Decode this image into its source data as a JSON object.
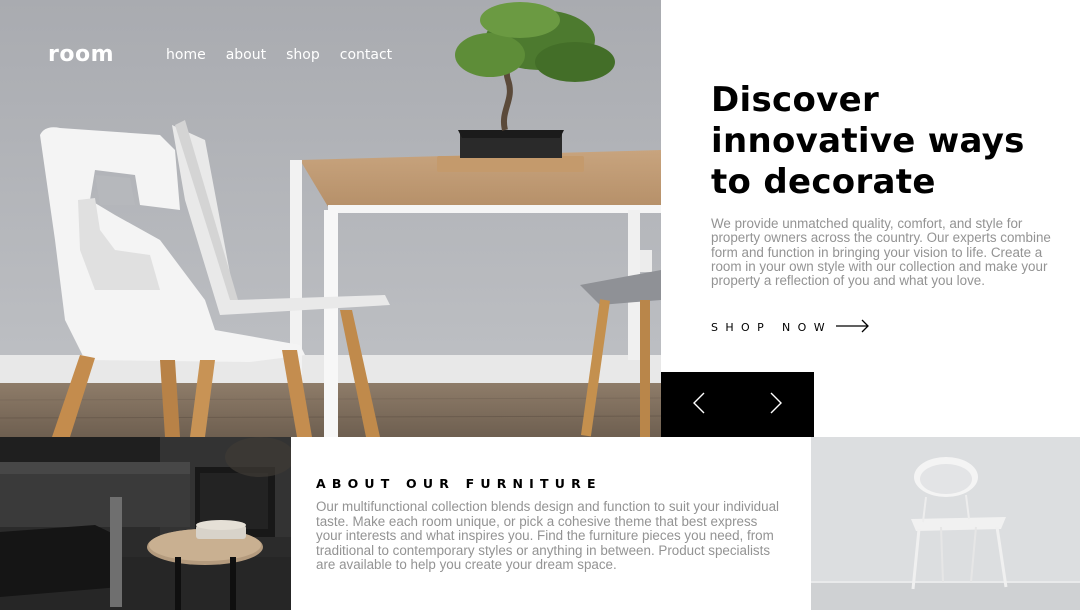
{
  "header": {
    "logo": "room",
    "nav": [
      "home",
      "about",
      "shop",
      "contact"
    ]
  },
  "hero": {
    "image_alt": "White chairs around a wooden table with a bonsai tree",
    "title_lines": [
      "Discover",
      "innovative ways",
      "to decorate"
    ],
    "description": "We provide unmatched quality, comfort, and style for property owners across the country. Our experts combine form and function in bringing your vision to life. Create a room in your own style with our collection and make your property a reflection of you and what you love.",
    "cta_label": "SHOP NOW",
    "cta_icon": "arrow-right-icon"
  },
  "slider": {
    "prev_icon": "chevron-left-icon",
    "next_icon": "chevron-right-icon"
  },
  "about": {
    "title": "ABOUT OUR FURNITURE",
    "description": "Our multifunctional collection blends design and function to suit your individual taste. Make each room unique, or pick a cohesive theme that best express your interests and what inspires you. Find the furniture pieces you need, from traditional to contemporary styles or anything in between. Product specialists are available to help you create your dream space.",
    "image_dark_alt": "Dark room with black armchair and round coffee table",
    "image_light_alt": "White chair against a light grey wall"
  },
  "colors": {
    "text_primary": "#000000",
    "text_muted": "#939393",
    "control_bg": "#000000",
    "page_bg": "#ffffff"
  }
}
